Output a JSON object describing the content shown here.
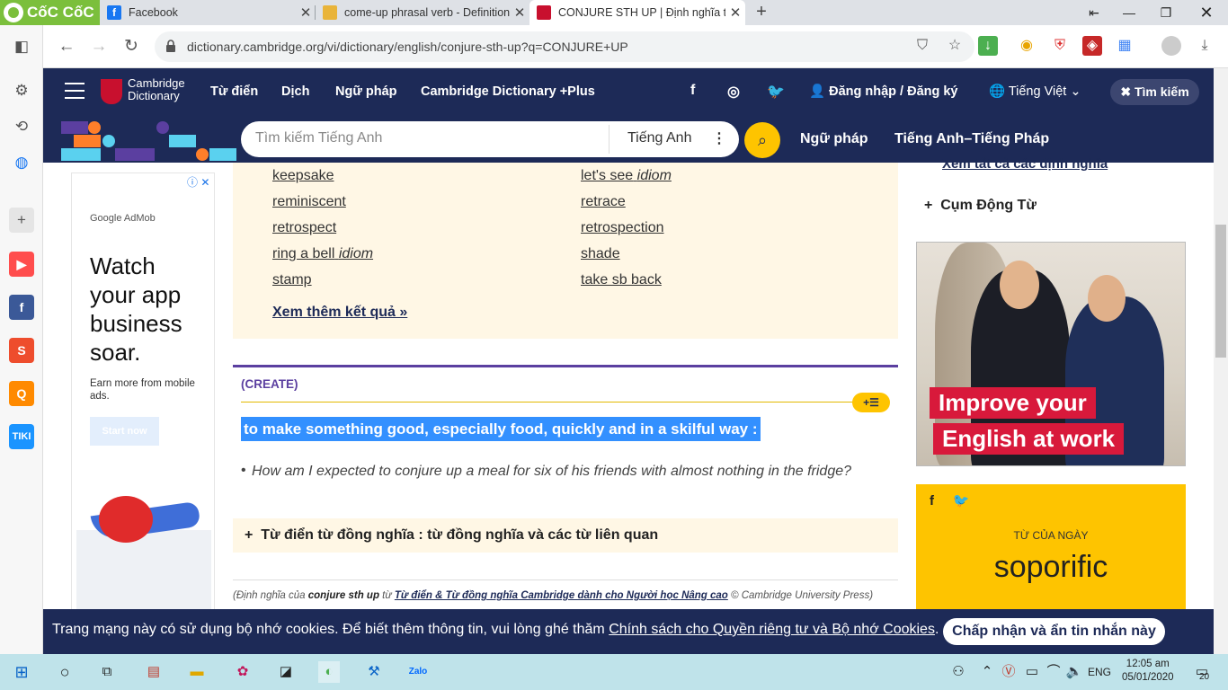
{
  "browser": {
    "brand": "CốC CốC",
    "tabs": [
      {
        "title": "Facebook",
        "icon": "facebook-icon"
      },
      {
        "title": "come-up phrasal verb - Definition...",
        "icon": "dictionary-icon"
      },
      {
        "title": "CONJURE STH UP | Định nghĩa tro...",
        "icon": "cambridge-icon",
        "active": true
      }
    ],
    "url": "dictionary.cambridge.org/vi/dictionary/english/conjure-sth-up?q=CONJURE+UP"
  },
  "site": {
    "logo_line1": "Cambridge",
    "logo_line2": "Dictionary",
    "nav": [
      "Từ điển",
      "Dịch",
      "Ngữ pháp",
      "Cambridge Dictionary +Plus"
    ],
    "login": "Đăng nhập / Đăng ký",
    "language": "Tiếng Việt",
    "search_close": "Tìm kiếm",
    "search_placeholder": "Tìm kiếm Tiếng Anh",
    "search_dict": "Tiếng Anh",
    "nav2": [
      "Ngữ pháp",
      "Tiếng Anh–Tiếng Pháp"
    ],
    "colors": {
      "navy": "#1d2a57",
      "yellow": "#fec400",
      "purple": "#5b3fa0"
    }
  },
  "ad": {
    "brand": "Google AdMob",
    "headline": "Watch your app business soar.",
    "sub": "Earn more from mobile ads.",
    "button": "Start now"
  },
  "thesaurus": {
    "left": [
      {
        "word": "keepsake",
        "tag": ""
      },
      {
        "word": "reminiscent",
        "tag": ""
      },
      {
        "word": "retrospect",
        "tag": ""
      },
      {
        "word": "ring a bell",
        "tag": "idiom"
      },
      {
        "word": "stamp",
        "tag": ""
      }
    ],
    "right": [
      {
        "word": "let's see",
        "tag": "idiom"
      },
      {
        "word": "retrace",
        "tag": ""
      },
      {
        "word": "retrospection",
        "tag": ""
      },
      {
        "word": "shade",
        "tag": ""
      },
      {
        "word": "take sb back",
        "tag": ""
      }
    ],
    "more": "Xem thêm kết quả »"
  },
  "entry": {
    "guide": "(CREATE)",
    "plus": "+☰",
    "definition": "to make something good, especially food, quickly and in a skilful way :",
    "example": "How am I expected to conjure up a meal for six of his friends with almost nothing in the fridge?",
    "synonyms": "Từ điển từ đồng nghĩa : từ đồng nghĩa và các từ liên quan",
    "credit_prefix": "(Định nghĩa của ",
    "credit_word": "conjure sth up",
    "credit_mid": " từ ",
    "credit_link": "Từ điển & Từ đồng nghĩa Cambridge dành cho Người học Nâng cao",
    "credit_suffix": " © Cambridge University Press)"
  },
  "right": {
    "see_all": "Xem tất cả các định nghĩa",
    "phrasal": "Cụm Động Từ",
    "promo_line1": "Improve your",
    "promo_line2": "English at work",
    "wod_label": "TỪ CỦA NGÀY",
    "wod_word": "soporific"
  },
  "cookie": {
    "text": "Trang mạng này có sử dụng bộ nhớ cookies. Để biết thêm thông tin, vui lòng ghé thăm ",
    "link": "Chính sách cho Quyền riêng tư và Bộ nhớ Cookies",
    "end": ".",
    "button": "Chấp nhận và ẩn tin nhắn này"
  },
  "taskbar": {
    "lang": "ENG",
    "time": "12:05 am",
    "date": "05/01/2020",
    "notifications": "20"
  }
}
